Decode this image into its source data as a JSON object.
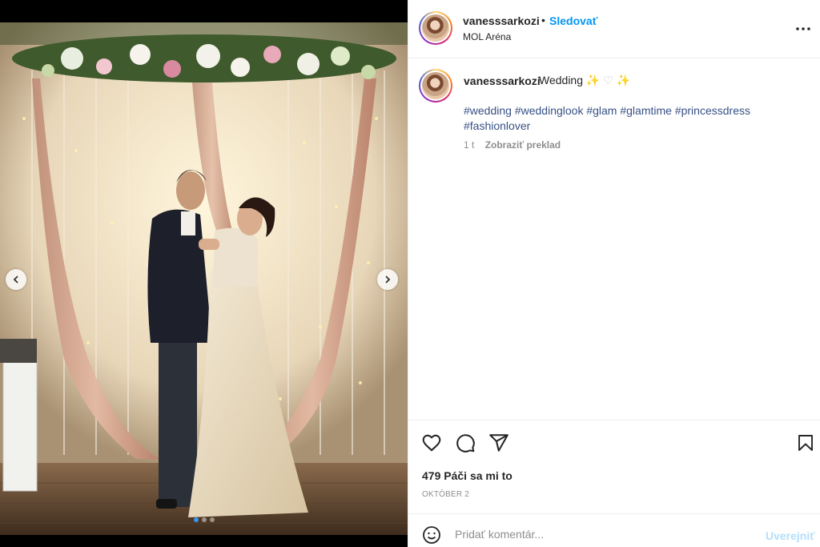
{
  "post": {
    "username": "vanesssarkozi",
    "follow_label": "Sledovať",
    "separator": "•",
    "location": "MOL Aréna",
    "caption": {
      "username": "vanesssarkozi",
      "text": "Wedding",
      "emojis": [
        "✨",
        "♡",
        "✨"
      ],
      "hashtags_line1": "#wedding #weddinglook #glam #glamtime #princessdress",
      "hashtags_line2": "#fashionlover",
      "time_ago": "1 t",
      "translate_label": "Zobraziť preklad"
    },
    "likes": "479 Páči sa mi to",
    "date": "OKTÓBER 2",
    "comment_placeholder": "Pridať komentár...",
    "post_button": "Uverejniť"
  },
  "carousel": {
    "total_slides": 3,
    "active_slide": 1
  },
  "icons": {
    "more": "more-options-icon",
    "like": "heart-icon",
    "comment": "comment-icon",
    "share": "share-icon",
    "save": "bookmark-icon",
    "emoji": "emoji-icon",
    "prev": "chevron-left-icon",
    "next": "chevron-right-icon"
  },
  "colors": {
    "link_blue": "#0095f6",
    "hashtag": "#385185",
    "muted": "#8e8e8e",
    "post_disabled": "#b2dffc"
  }
}
